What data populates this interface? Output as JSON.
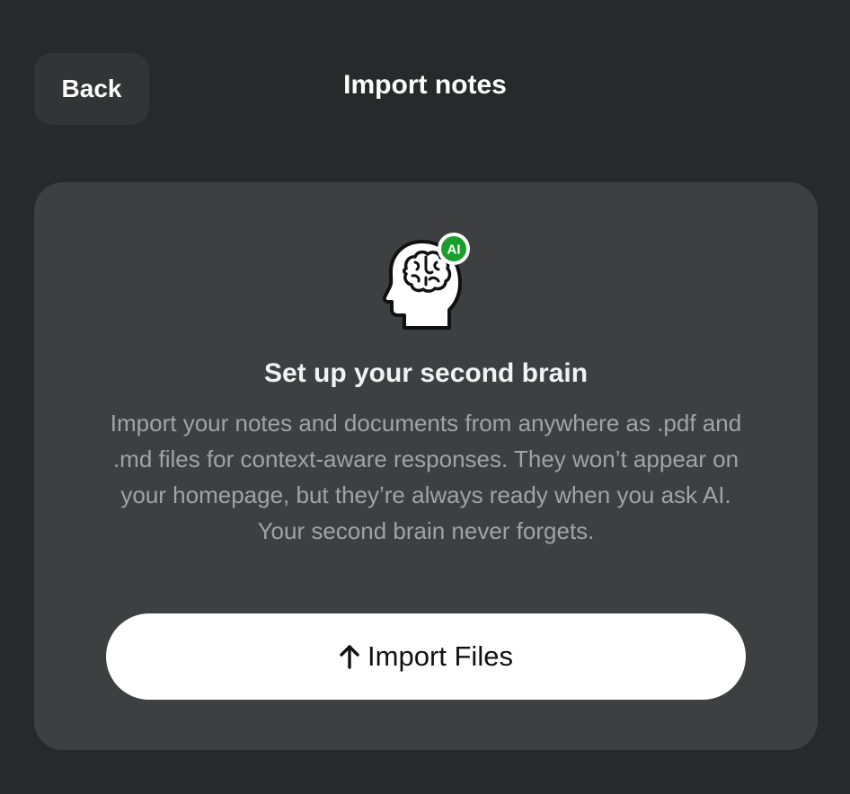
{
  "header": {
    "back_label": "Back",
    "title": "Import notes"
  },
  "card": {
    "icon": "brain-ai-icon",
    "badge_label": "AI",
    "title": "Set up your second brain",
    "description": "Import your notes and documents from anywhere as .pdf and .md files for context-aware responses. They won’t appear on your homepage, but they’re always ready when you ask AI. Your second brain never forgets.",
    "import_button_label": "Import Files",
    "import_button_icon": "arrow-up-icon"
  },
  "colors": {
    "background": "#28292b",
    "card": "#3e3f41",
    "badge_green": "#1a9e2c",
    "button_bg": "#ffffff"
  }
}
